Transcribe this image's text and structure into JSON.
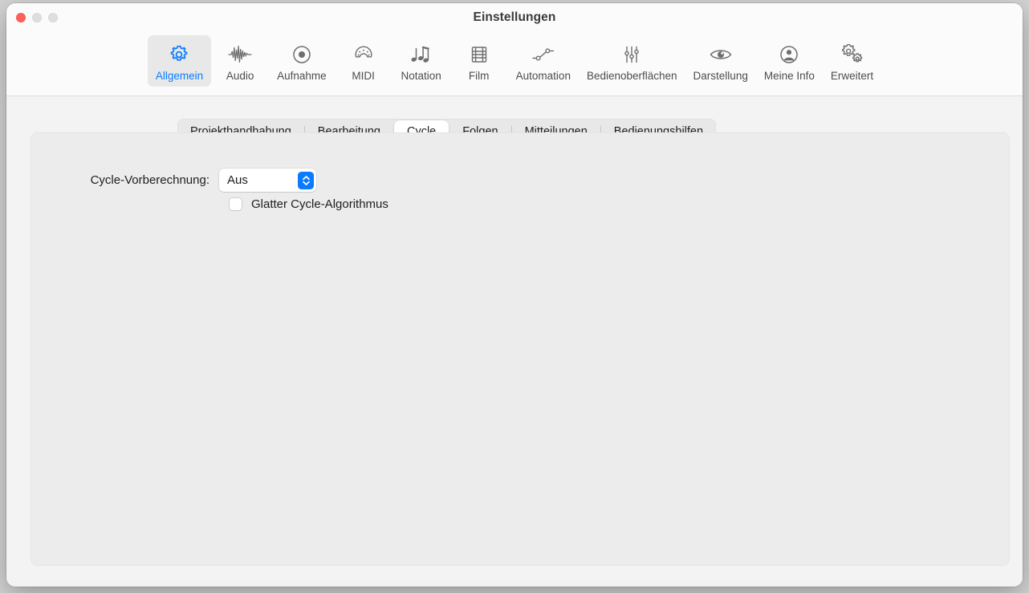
{
  "window": {
    "title": "Einstellungen",
    "traffic_lights": [
      {
        "name": "close",
        "color": "#fc6058"
      },
      {
        "name": "minimize",
        "color": "#dedede"
      },
      {
        "name": "maximize",
        "color": "#dedede"
      }
    ]
  },
  "toolbar": {
    "selected": "Allgemein",
    "accent_color": "#0a7bff",
    "items": [
      {
        "label": "Allgemein",
        "icon": "gear-icon",
        "selected": true
      },
      {
        "label": "Audio",
        "icon": "waveform-icon",
        "selected": false
      },
      {
        "label": "Aufnahme",
        "icon": "record-circle-icon",
        "selected": false
      },
      {
        "label": "MIDI",
        "icon": "midi-connector-icon",
        "selected": false
      },
      {
        "label": "Notation",
        "icon": "music-notes-icon",
        "selected": false
      },
      {
        "label": "Film",
        "icon": "film-strip-icon",
        "selected": false
      },
      {
        "label": "Automation",
        "icon": "automation-node-icon",
        "selected": false
      },
      {
        "label": "Bedienoberflächen",
        "icon": "sliders-icon",
        "selected": false
      },
      {
        "label": "Darstellung",
        "icon": "eye-icon",
        "selected": false
      },
      {
        "label": "Meine Info",
        "icon": "person-circle-icon",
        "selected": false
      },
      {
        "label": "Erweitert",
        "icon": "double-gear-icon",
        "selected": false
      }
    ]
  },
  "tabs": {
    "selected": "Cycle",
    "items": [
      {
        "label": "Projekthandhabung",
        "selected": false
      },
      {
        "label": "Bearbeitung",
        "selected": false
      },
      {
        "label": "Cycle",
        "selected": true
      },
      {
        "label": "Folgen",
        "selected": false
      },
      {
        "label": "Mitteilungen",
        "selected": false
      },
      {
        "label": "Bedienungshilfen",
        "selected": false
      }
    ]
  },
  "panel": {
    "cycle_precompute": {
      "label": "Cycle-Vorberechnung:",
      "value": "Aus",
      "options": [
        "Aus"
      ]
    },
    "smooth_cycle": {
      "label": "Glatter Cycle-Algorithmus",
      "checked": false
    }
  }
}
